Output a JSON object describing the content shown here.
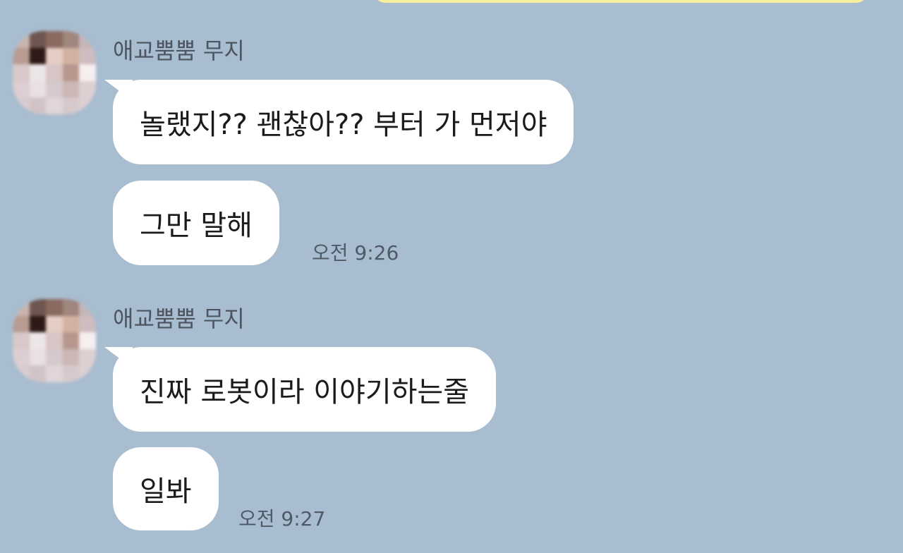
{
  "messages": [
    {
      "sender": "애교뿜뿜 무지",
      "bubbles": [
        "놀랬지?? 괜찮아?? 부터 가 먼저야",
        "그만 말해"
      ],
      "time": "오전 9:26"
    },
    {
      "sender": "애교뿜뿜 무지",
      "bubbles": [
        "진짜 로봇이라 이야기하는줄",
        "일봐"
      ],
      "time": "오전 9:27"
    }
  ],
  "colors": {
    "chat_background": "#a9bdd0",
    "bubble": "#ffffff",
    "my_bubble": "#f7f0a0"
  },
  "icons": {
    "avatar": "pixelated-avatar-icon"
  }
}
